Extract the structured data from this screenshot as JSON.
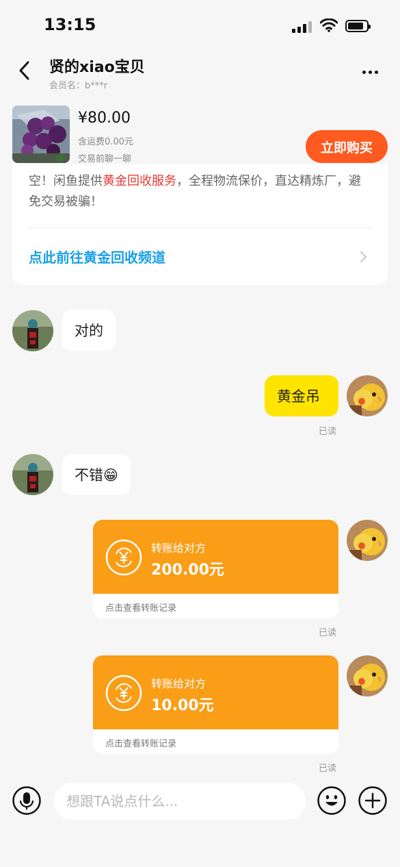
{
  "status_bar": {
    "time": "13:15"
  },
  "header": {
    "title": "贤的xiao宝贝",
    "subtitle": "会员名：b***r"
  },
  "product": {
    "price": "¥80.00",
    "shipping": "含运费0.00元",
    "negotiate": "交易前聊一聊",
    "buy_label": "立即购买"
  },
  "notice": {
    "text_before": "空！闲鱼提供",
    "highlight": "黄金回收服务",
    "text_after": "，全程物流保价，直达精炼厂，避免交易被骗！",
    "link_label": "点此前往黄金回收频道"
  },
  "messages": [
    {
      "text": "对的"
    },
    {
      "text": "黄金吊",
      "status": "已读"
    },
    {
      "text": "不错😁"
    }
  ],
  "transfers": [
    {
      "label": "转账给对方",
      "amount": "200.00元",
      "footer": "点击查看转账记录",
      "status": "已读"
    },
    {
      "label": "转账给对方",
      "amount": "10.00元",
      "footer": "点击查看转账记录",
      "status": "已读"
    }
  ],
  "input": {
    "placeholder": "想跟TA说点什么..."
  },
  "icons": {
    "back": "chevron-left-icon",
    "more": "more-dots-icon",
    "mic": "microphone-icon",
    "emoji": "emoji-icon",
    "plus": "plus-icon",
    "coin": "yuan-coin-icon"
  },
  "colors": {
    "accent_orange": "#ff5a1f",
    "transfer_orange": "#fa9d17",
    "bubble_yellow": "#ffe400",
    "link_blue": "#1aa0e6",
    "highlight_red": "#e53935"
  }
}
